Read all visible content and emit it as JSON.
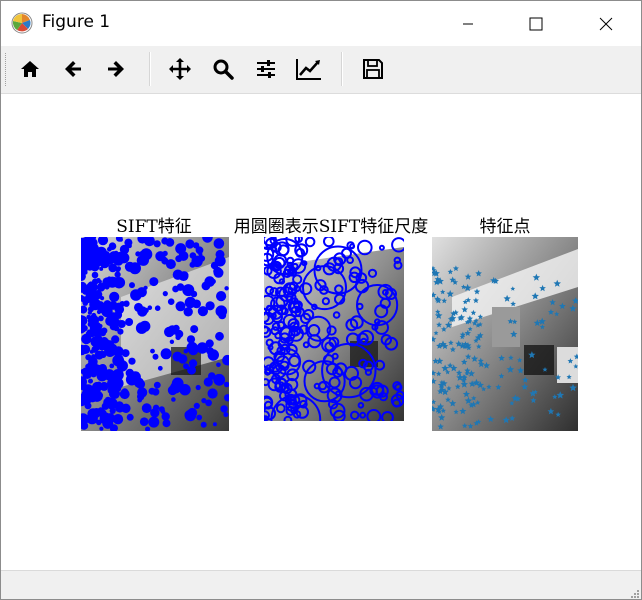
{
  "window": {
    "title": "Figure 1",
    "controls": [
      "minimize",
      "maximize",
      "close"
    ]
  },
  "toolbar": {
    "buttons": [
      {
        "icon": "home-icon",
        "tooltip": "Home"
      },
      {
        "icon": "back-arrow-icon",
        "tooltip": "Back"
      },
      {
        "icon": "forward-arrow-icon",
        "tooltip": "Forward"
      },
      {
        "icon": "pan-icon",
        "tooltip": "Pan"
      },
      {
        "icon": "zoom-icon",
        "tooltip": "Zoom"
      },
      {
        "icon": "subplots-icon",
        "tooltip": "Configure subplots"
      },
      {
        "icon": "edit-curve-icon",
        "tooltip": "Edit axis"
      },
      {
        "icon": "save-icon",
        "tooltip": "Save"
      }
    ]
  },
  "figure": {
    "subplots": [
      {
        "title": "SIFT特征",
        "marker_color": "#0000ff",
        "marker_style": "filled-dots"
      },
      {
        "title": "用圆圈表示SIFT特征尺度",
        "marker_color": "#0000ff",
        "marker_style": "circles"
      },
      {
        "title": "特征点",
        "marker_color": "#1f77b4",
        "marker_style": "stars"
      }
    ]
  },
  "colors": {
    "accent_blue": "#0000ff",
    "keypoint_blue": "#1f77b4",
    "toolbar_bg": "#f0f0f0"
  }
}
